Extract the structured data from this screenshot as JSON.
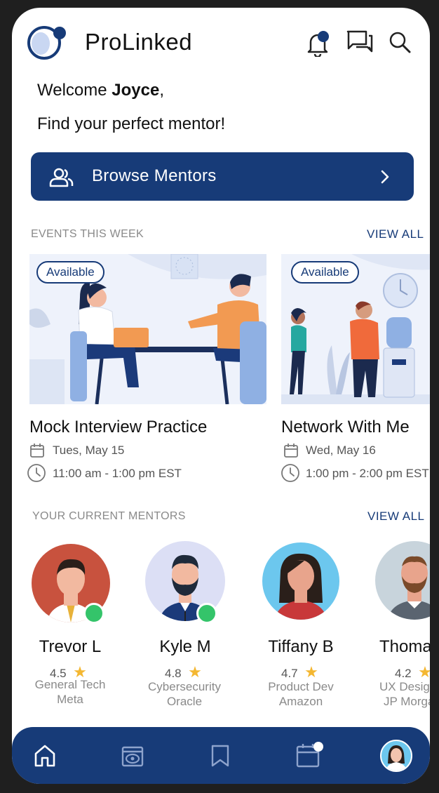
{
  "header": {
    "app_name": "ProLinked"
  },
  "greeting": {
    "prefix": "Welcome ",
    "user": "Joyce",
    "suffix": ",",
    "subtitle": "Find your perfect mentor!"
  },
  "browse": {
    "label": "Browse Mentors"
  },
  "events": {
    "section_title": "EVENTS THIS WEEK",
    "view_all": "VIEW ALL",
    "items": [
      {
        "badge": "Available",
        "title": "Mock Interview Practice",
        "date": "Tues, May 15",
        "time": "11:00 am - 1:00 pm EST"
      },
      {
        "badge": "Available",
        "title": "Network With Me",
        "date": "Wed, May 16",
        "time": "1:00 pm - 2:00 pm EST"
      }
    ]
  },
  "mentors": {
    "section_title": "YOUR CURRENT MENTORS",
    "view_all": "VIEW ALL",
    "items": [
      {
        "name": "Trevor L",
        "rating": "4.5",
        "role": "General Tech",
        "company": "Meta",
        "online": true
      },
      {
        "name": "Kyle M",
        "rating": "4.8",
        "role": "Cybersecurity",
        "company": "Oracle",
        "online": true
      },
      {
        "name": "Tiffany B",
        "rating": "4.7",
        "role": "Product Dev",
        "company": "Amazon",
        "online": false
      },
      {
        "name": "Thomas",
        "rating": "4.2",
        "role": "UX Design",
        "company": "JP Morgan",
        "online": false
      }
    ]
  },
  "tabbar": {
    "items": [
      "home-icon",
      "watch-icon",
      "bookmark-icon",
      "calendar-icon",
      "profile-avatar"
    ]
  },
  "colors": {
    "brand": "#173b78",
    "star": "#f4b731",
    "online": "#34c46a"
  }
}
